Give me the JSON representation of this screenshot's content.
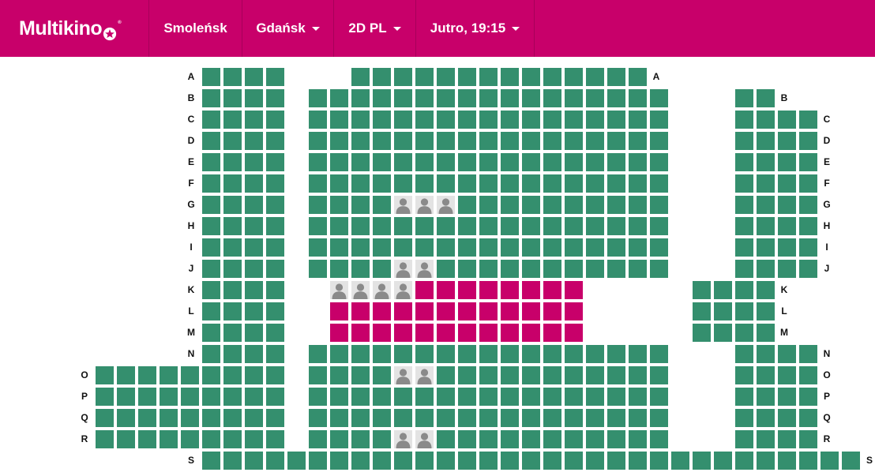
{
  "brand": {
    "name": "Multikino",
    "registered_mark": "®"
  },
  "nav": {
    "cinema": "Smoleńsk",
    "city": "Gdańsk",
    "format": "2D PL",
    "showtime": "Jutro, 19:15"
  },
  "colors": {
    "brand": "#c8006a",
    "seat_available": "#348f6e",
    "seat_selected": "#c8006a",
    "seat_taken": "#e3e3e3"
  },
  "icons": {
    "logo_star": "star-icon",
    "dropdown": "chevron-down-icon",
    "taken_seat": "person-icon"
  },
  "seat_map": {
    "rows": [
      {
        "label": "A",
        "seats": "AAAA...AAAAAAAAAAAAAA..."
      },
      {
        "label": "B",
        "seats": "AAAA.AAAAAAAAAAAAAAAAA...AA"
      },
      {
        "label": "C",
        "seats": "AAAA.AAAAAAAAAAAAAAAAA...AAAA"
      },
      {
        "label": "D",
        "seats": "AAAA.AAAAAAAAAAAAAAAAA...AAAA"
      },
      {
        "label": "E",
        "seats": "AAAA.AAAAAAAAAAAAAAAAA...AAAA"
      },
      {
        "label": "F",
        "seats": "AAAA.AAAAAAAAAAAAAAAAA...AAAA"
      },
      {
        "label": "G",
        "seats": "AAAA.AAAAOOOAAAAAAAAAA...AAAA"
      },
      {
        "label": "H",
        "seats": "AAAA.AAAAAAAAAAAAAAAAA...AAAA"
      },
      {
        "label": "I",
        "seats": "AAAA.AAAAAAAAAAAAAAAAA...AAAA"
      },
      {
        "label": "J",
        "seats": "AAAA.AAAAOOAAAAAAAAAAA...AAAA"
      },
      {
        "label": "K",
        "seats": "AAAA..OOOOSSSSSSSS.....AAAA"
      },
      {
        "label": "L",
        "seats": "AAAA..SSSSSSSSSSSS.....AAAA"
      },
      {
        "label": "M",
        "seats": "AAAA..SSSSSSSSSSSS.....AAAA"
      },
      {
        "label": "N",
        "seats": "AAAA.AAAAAAAAAAAAAAAAA...AAAA"
      },
      {
        "label": "O",
        "seats": "AAAAAAAAA.AAAAOOAAAAAAAAAAA...AAAA"
      },
      {
        "label": "P",
        "seats": "AAAAAAAAA.AAAAAAAAAAAAAAAAA...AAAA"
      },
      {
        "label": "Q",
        "seats": "AAAAAAAAA.AAAAAAAAAAAAAAAAA...AAAA"
      },
      {
        "label": "R",
        "seats": "AAAAAAAAA.AAAAOOAAAAAAAAAAA...AAAA"
      },
      {
        "label": "S",
        "seats": "AAAAAAAAAAAAAAAAAAAAAAAAAAAAAAA"
      }
    ],
    "legend_codes": {
      "A": "available",
      "S": "selected",
      "O": "occupied",
      ".": "gap"
    }
  }
}
